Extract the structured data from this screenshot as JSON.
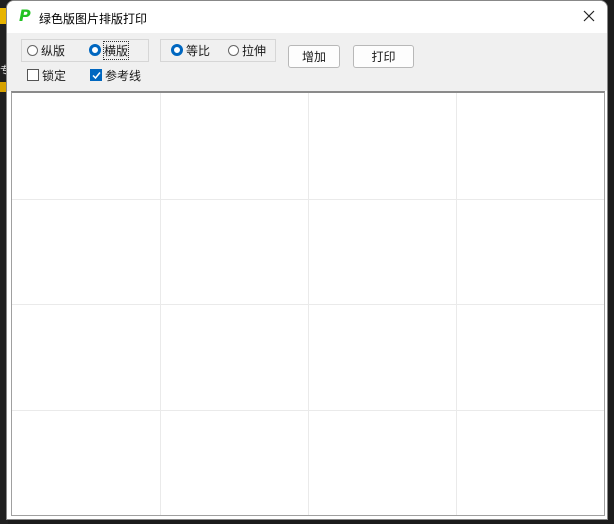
{
  "window": {
    "title": "绿色版图片排版打印",
    "icon": "app-p-icon",
    "icon_glyph": "P"
  },
  "background": {
    "left_glyph": "专"
  },
  "orientation": {
    "portrait_label": "纵版",
    "landscape_label": "横版",
    "selected": "landscape"
  },
  "scaling": {
    "proportional_label": "等比",
    "stretch_label": "拉伸",
    "selected": "proportional"
  },
  "options": {
    "lock_label": "锁定",
    "lock_checked": false,
    "guides_label": "参考线",
    "guides_checked": true
  },
  "buttons": {
    "add_label": "增加",
    "print_label": "打印"
  },
  "grid": {
    "columns": 4,
    "rows": 4
  },
  "colors": {
    "accent": "#0067c0",
    "icon_green": "#22c322",
    "grid_line": "#eaeaea"
  }
}
